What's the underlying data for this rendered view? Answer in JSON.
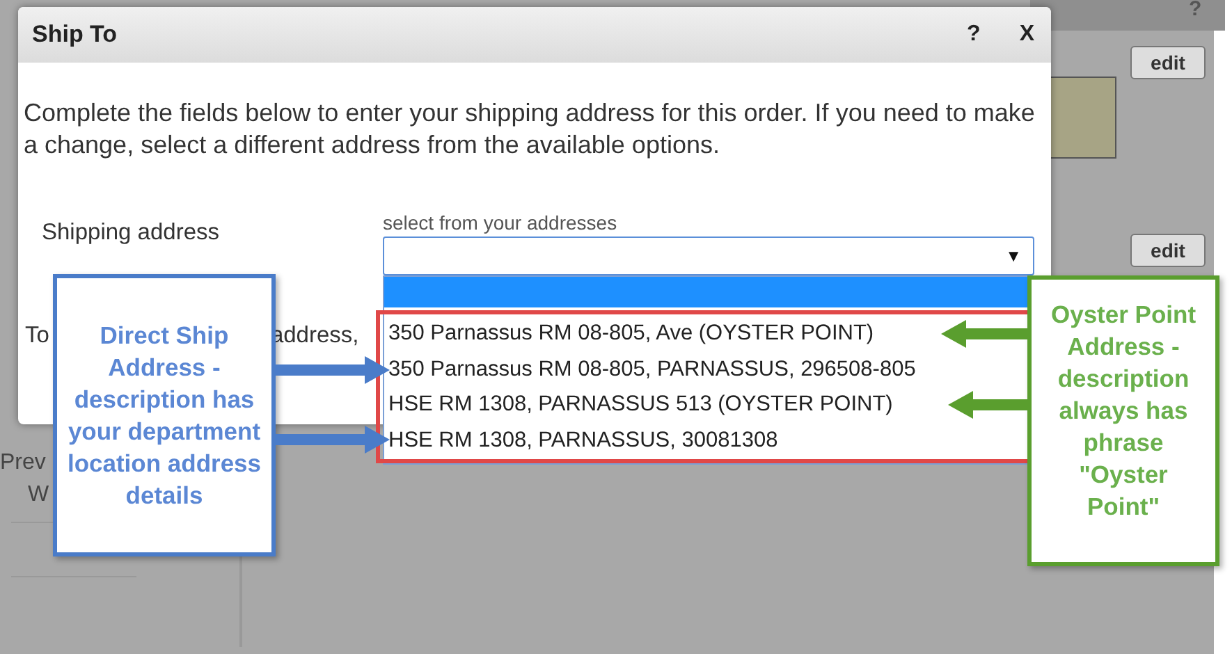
{
  "background": {
    "help": "?",
    "edit_buttons": [
      "edit",
      "edit"
    ],
    "left_labels": [
      "Prev",
      "W"
    ]
  },
  "dialog": {
    "title": "Ship To",
    "help": "?",
    "close": "X",
    "intro": "Complete the fields below to enter your shipping address for this order. If you need to make a change, select a different address from the available options.",
    "field_label": "Shipping address",
    "select_hint": "select from your addresses",
    "select_arrow": "▼",
    "partial_labels": [
      "To",
      "address,"
    ]
  },
  "dropdown": {
    "blank_highlighted": true,
    "options": [
      "350 Parnassus RM 08-805, Ave (OYSTER POINT)",
      "350 Parnassus RM 08-805, PARNASSUS, 296508-805",
      "HSE RM 1308, PARNASSUS 513 (OYSTER POINT)",
      "HSE RM 1308, PARNASSUS, 30081308"
    ]
  },
  "callouts": [
    {
      "kind": "left",
      "color": "#4a7cc9",
      "text": "Direct Ship Address - description has your department location address details"
    },
    {
      "kind": "right",
      "color": "#5a9e2e",
      "text": "Oyster Point Address - description always has phrase \"Oyster Point\""
    }
  ]
}
